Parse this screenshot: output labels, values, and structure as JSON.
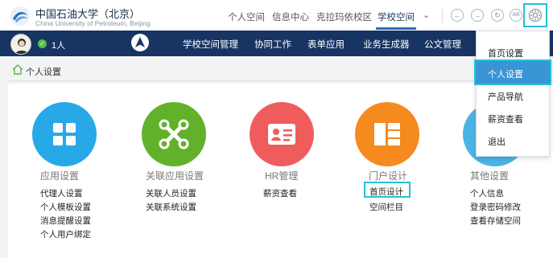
{
  "brand": {
    "name_cn": "中国石油大学（北京）",
    "name_en": "China University of Petroleum, Beijing"
  },
  "topnav": {
    "items": [
      "个人空间",
      "信息中心",
      "克拉玛依校区",
      "学校空间"
    ],
    "active": "学校空间"
  },
  "toolbar_icons": [
    "back-icon",
    "forward-icon",
    "refresh-icon",
    "ab-icon",
    "gear-icon"
  ],
  "toolbar": {
    "ab_label": "AB"
  },
  "user": {
    "online_count": "1人"
  },
  "mainnav": {
    "items": [
      "学校空间管理",
      "协同工作",
      "表单应用",
      "业务生成器",
      "公文管理"
    ]
  },
  "breadcrumb": {
    "label": "个人设置"
  },
  "categories": [
    {
      "title": "应用设置",
      "color": "#29a8e8",
      "icon": "grid-icon",
      "links": [
        "代理人设置",
        "个人模板设置",
        "消息提醒设置",
        "个人用户绑定"
      ]
    },
    {
      "title": "关联应用设置",
      "color": "#62b12b",
      "icon": "link-icon",
      "links": [
        "关联人员设置",
        "关联系统设置"
      ]
    },
    {
      "title": "HR管理",
      "color": "#ef5c5c",
      "icon": "id-card-icon",
      "links": [
        "薪资查看"
      ]
    },
    {
      "title": "门户设计",
      "color": "#f58a1f",
      "icon": "layout-icon",
      "links": [
        "首页设计",
        "空间栏目"
      ]
    },
    {
      "title": "其他设置",
      "color": "#4bb4e6",
      "icon": "settings-icon",
      "links": [
        "个人信息",
        "登录密码修改",
        "查看存储空间"
      ]
    }
  ],
  "dropdown": {
    "items": [
      "首页设置",
      "个人设置",
      "产品导航",
      "薪资查看",
      "退出"
    ],
    "active": "个人设置"
  },
  "colors": {
    "nav_bg": "#173462",
    "highlight": "#22c3d8",
    "dropdown_active": "#3a95d6"
  }
}
